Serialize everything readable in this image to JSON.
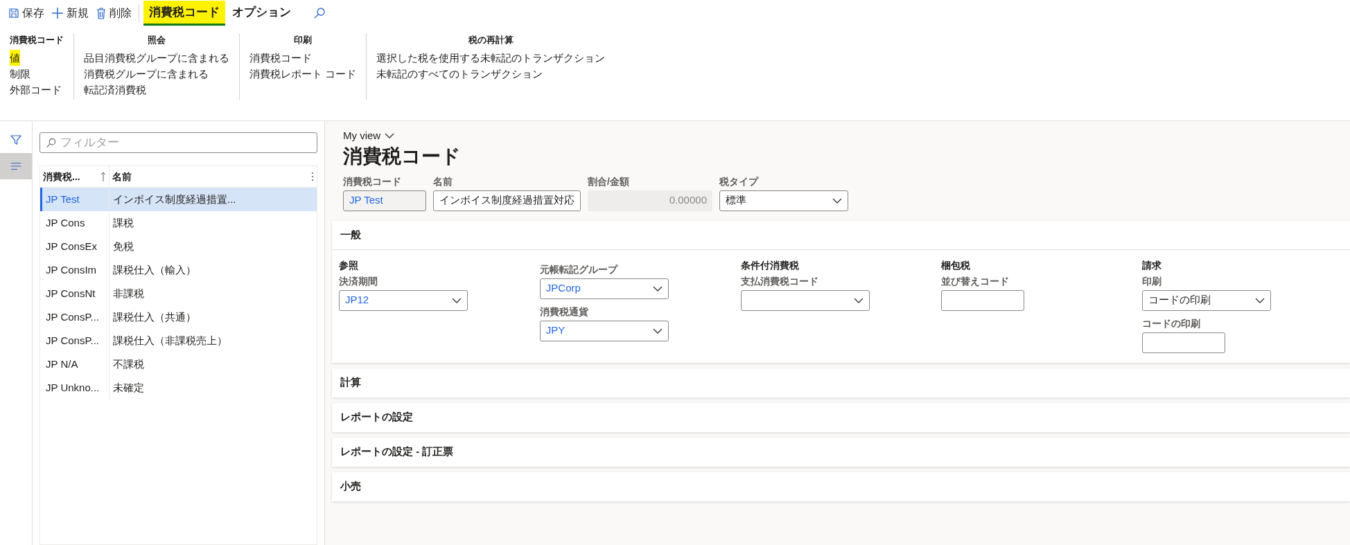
{
  "toolbar": {
    "actions": [
      {
        "label": "保存",
        "kind": "save"
      },
      {
        "label": "新規",
        "kind": "new"
      },
      {
        "label": "削除",
        "kind": "delete"
      }
    ],
    "tabs": [
      {
        "label": "消費税コード",
        "selected": true,
        "highlighted": true
      },
      {
        "label": "オプション",
        "selected": false,
        "highlighted": false
      }
    ]
  },
  "ribbon": [
    {
      "title": "消費税コード",
      "items": [
        {
          "label": "値",
          "highlighted": true
        },
        {
          "label": "制限",
          "highlighted": false
        },
        {
          "label": "外部コード",
          "highlighted": false
        }
      ]
    },
    {
      "title": "照会",
      "items": [
        {
          "label": "品目消費税グループに含まれる",
          "highlighted": false
        },
        {
          "label": "消費税グループに含まれる",
          "highlighted": false
        },
        {
          "label": "転記済消費税",
          "highlighted": false
        }
      ]
    },
    {
      "title": "印刷",
      "items": [
        {
          "label": "消費税コード",
          "highlighted": false
        },
        {
          "label": "消費税レポート コード",
          "highlighted": false
        }
      ]
    },
    {
      "title": "税の再計算",
      "items": [
        {
          "label": "選択した税を使用する未転記のトランザクション",
          "highlighted": false
        },
        {
          "label": "未転記のすべてのトランザクション",
          "highlighted": false
        }
      ]
    }
  ],
  "rail": [
    {
      "kind": "filter",
      "selected": false
    },
    {
      "kind": "list",
      "selected": true
    }
  ],
  "list": {
    "filter_placeholder": "フィルター",
    "columns": [
      {
        "label": "消費税...",
        "sorted": true
      },
      {
        "label": "名前",
        "sorted": false
      }
    ],
    "rows": [
      {
        "code": "JP Test",
        "name": "インボイス制度経過措置...",
        "selected": true
      },
      {
        "code": "JP Cons",
        "name": "課税",
        "selected": false
      },
      {
        "code": "JP ConsEx",
        "name": "免税",
        "selected": false
      },
      {
        "code": "JP ConsIm",
        "name": "課税仕入（輸入）",
        "selected": false
      },
      {
        "code": "JP ConsNt",
        "name": "非課税",
        "selected": false
      },
      {
        "code": "JP ConsP...",
        "name": "課税仕入（共通）",
        "selected": false
      },
      {
        "code": "JP ConsP...",
        "name": "課税仕入（非課税売上）",
        "selected": false
      },
      {
        "code": "JP N/A",
        "name": "不課税",
        "selected": false
      },
      {
        "code": "JP Unkno...",
        "name": "未確定",
        "selected": false
      }
    ]
  },
  "main": {
    "view": "My view",
    "title": "消費税コード",
    "header_fields": [
      {
        "label": "消費税コード",
        "value": "JP Test",
        "kind": "readonly"
      },
      {
        "label": "名前",
        "value": "インボイス制度経過措置対応",
        "kind": "text"
      },
      {
        "label": "割合/金額",
        "value": "0.00000",
        "kind": "number",
        "disabled": true
      },
      {
        "label": "税タイプ",
        "value": "標準",
        "kind": "select"
      }
    ],
    "sections": [
      {
        "title": "一般",
        "expanded": true,
        "columns": [
          {
            "heading": "参照",
            "fields": [
              {
                "label": "決済期間",
                "value": "JP12",
                "kind": "lookup"
              }
            ]
          },
          {
            "fields": [
              {
                "label": "元帳転記グループ",
                "value": "JPCorp",
                "kind": "lookup"
              },
              {
                "label": "消費税通貨",
                "value": "JPY",
                "kind": "lookup"
              }
            ]
          },
          {
            "heading": "条件付消費税",
            "fields": [
              {
                "label": "支払消費税コード",
                "kind": "lookup"
              }
            ]
          },
          {
            "heading": "梱包税",
            "fields": [
              {
                "label": "並び替えコード",
                "kind": "text"
              }
            ]
          },
          {
            "heading": "請求",
            "fields": [
              {
                "label": "印刷",
                "value": "コードの印刷",
                "kind": "select"
              },
              {
                "label": "コードの印刷",
                "kind": "text"
              }
            ]
          }
        ]
      },
      {
        "title": "計算",
        "expanded": false
      },
      {
        "title": "レポートの設定",
        "expanded": false
      },
      {
        "title": "レポートの設定 - 訂正票",
        "expanded": false
      },
      {
        "title": "小売",
        "expanded": false
      }
    ]
  }
}
